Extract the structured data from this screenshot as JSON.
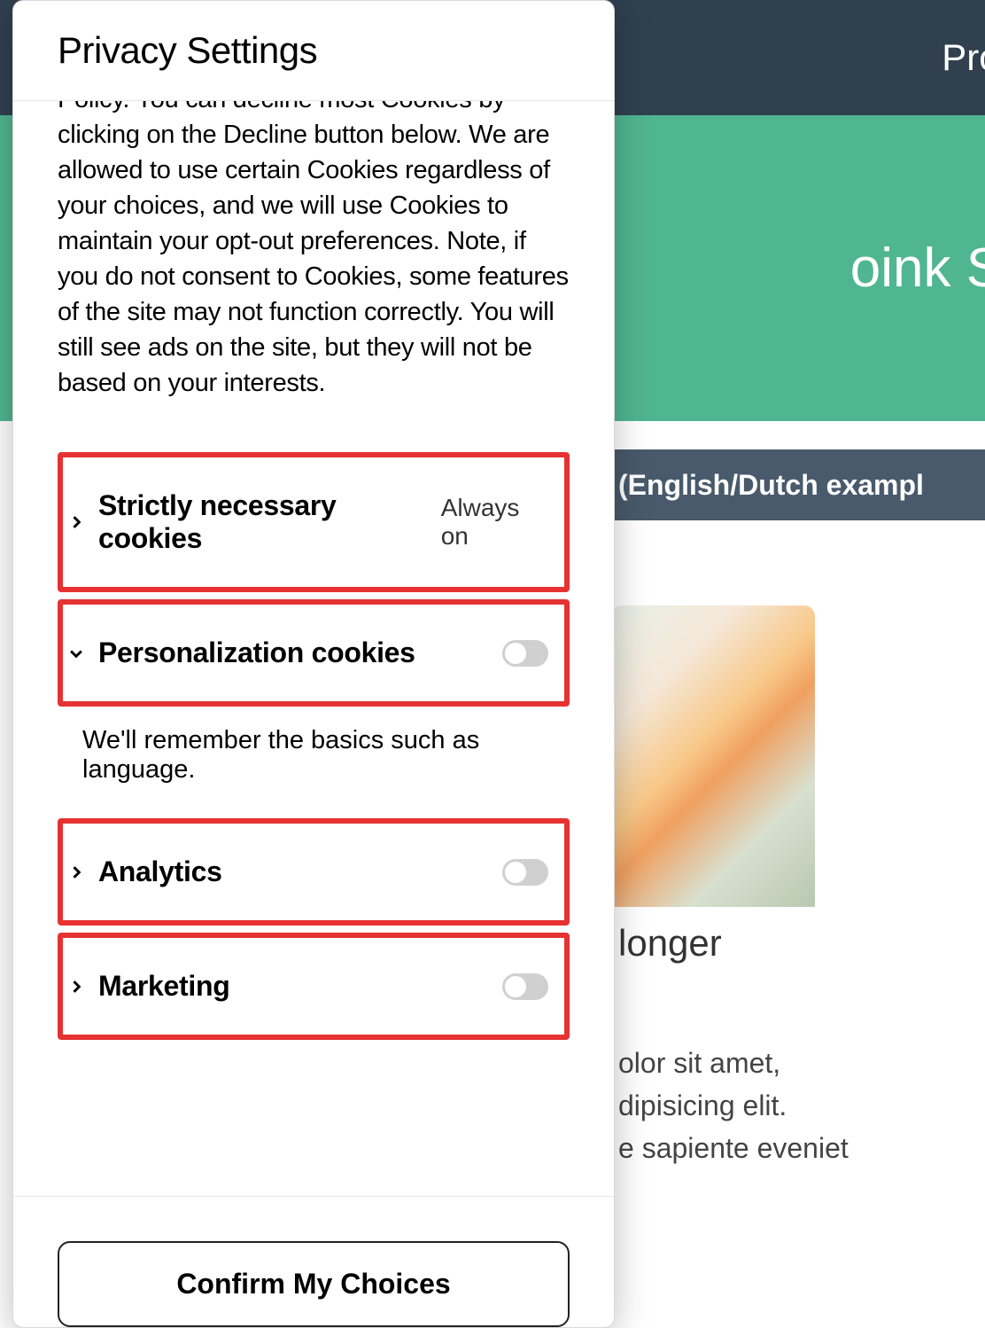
{
  "background": {
    "nav_link": "Prod",
    "hero_text": "oink Slam",
    "breadcrumb": "(English/Dutch exampl",
    "card_title": "longer",
    "card_body_1": "olor sit amet,",
    "card_body_2": "dipisicing elit.",
    "card_body_3": "e sapiente eveniet"
  },
  "modal": {
    "title": "Privacy Settings",
    "description": "Policy. You can decline most Cookies by clicking on the Decline button below. We are allowed to use certain Cookies regardless of your choices, and we will use Cookies to maintain your opt-out preferences. Note, if you do not consent to Cookies, some features of the site may not function correctly. You will still see ads on the site, but they will not be based on your interests.",
    "categories": {
      "strictly_necessary": {
        "label": "Strictly necessary cookies",
        "status": "Always on",
        "expanded": false
      },
      "personalization": {
        "label": "Personalization cookies",
        "expanded": true,
        "toggle_on": false,
        "description": "We'll remember the basics such as language."
      },
      "analytics": {
        "label": "Analytics",
        "expanded": false,
        "toggle_on": false
      },
      "marketing": {
        "label": "Marketing",
        "expanded": false,
        "toggle_on": false
      }
    },
    "confirm_label": "Confirm My Choices"
  }
}
